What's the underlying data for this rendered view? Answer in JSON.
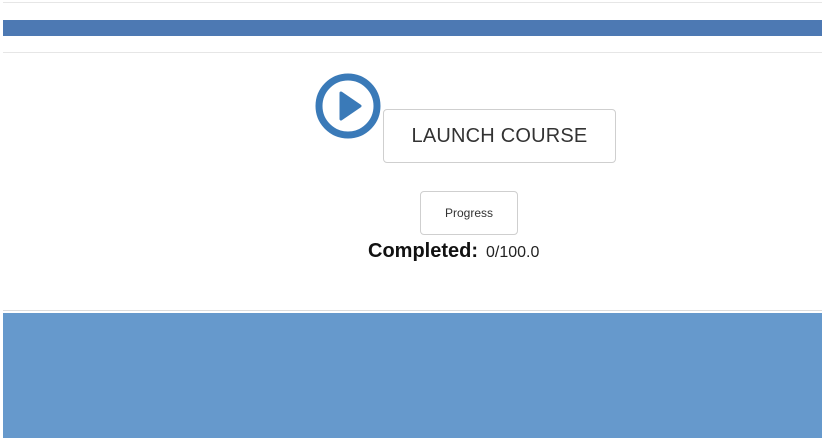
{
  "header": {
    "bar_color": "#4d79b3"
  },
  "course": {
    "play_icon": "play-circle-icon",
    "accent_color": "#3a7ab8",
    "launch_label": "LAUNCH COURSE",
    "progress_label": "Progress",
    "completed_label": "Completed:",
    "completed_value": "0/100.0"
  },
  "footer": {
    "color": "#6699cc"
  }
}
